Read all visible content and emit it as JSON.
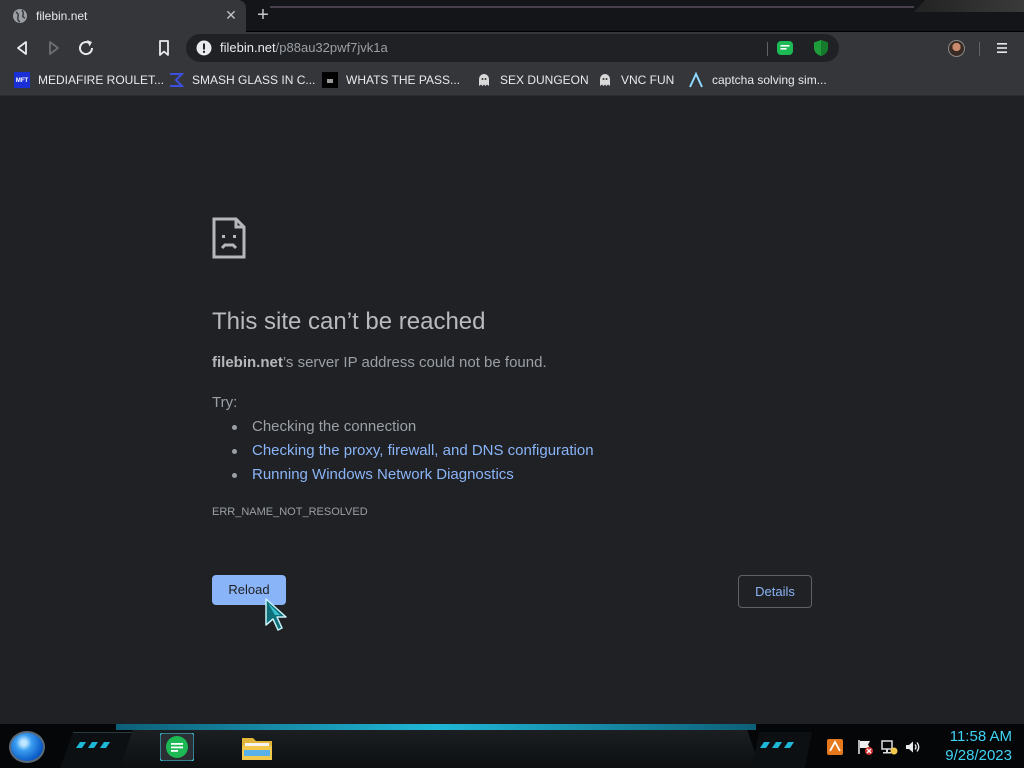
{
  "tab": {
    "title": "filebin.net",
    "close": "✕",
    "new_tab": "+"
  },
  "toolbar": {
    "url_host": "filebin.net",
    "url_path": "/p88au32pwf7jvk1a"
  },
  "bookmarks": [
    {
      "label": "MEDIAFIRE ROULET...",
      "icon": "mft-icon",
      "icon_text": "MFT"
    },
    {
      "label": "SMASH GLASS IN C...",
      "icon": "sigma-icon"
    },
    {
      "label": "WHATS THE PASS...",
      "icon": "black-square-icon"
    },
    {
      "label": "SEX DUNGEON",
      "icon": "ghost-icon"
    },
    {
      "label": "VNC FUN",
      "icon": "ghost-icon"
    },
    {
      "label": "captcha solving sim...",
      "icon": "lambda-icon"
    }
  ],
  "error": {
    "heading": "This site can’t be reached",
    "host": "filebin.net",
    "message_rest": "’s server IP address could not be found.",
    "try_label": "Try:",
    "suggestions": [
      "Checking the connection",
      "Checking the proxy, firewall, and DNS configuration",
      "Running Windows Network Diagnostics"
    ],
    "code": "ERR_NAME_NOT_RESOLVED",
    "reload_label": "Reload",
    "details_label": "Details"
  },
  "taskbar": {
    "time": "11:58 AM",
    "date": "9/28/2023"
  },
  "colors": {
    "accent_blue": "#8ab4f8",
    "clock_cyan": "#3fd3f3",
    "page_bg": "#202124"
  }
}
